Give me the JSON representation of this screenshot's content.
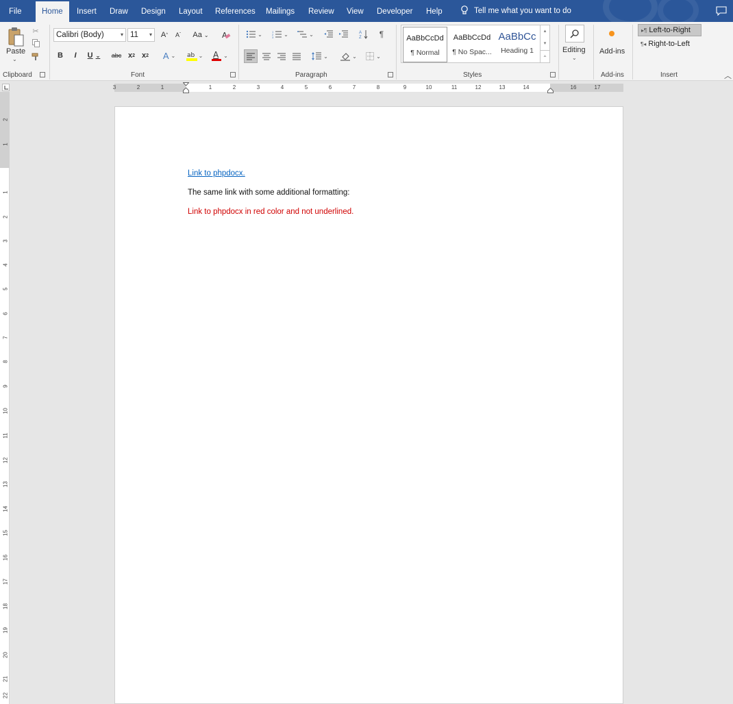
{
  "tabs": [
    {
      "label": "File",
      "active": false
    },
    {
      "label": "Home",
      "active": true
    },
    {
      "label": "Insert",
      "active": false
    },
    {
      "label": "Draw",
      "active": false
    },
    {
      "label": "Design",
      "active": false
    },
    {
      "label": "Layout",
      "active": false
    },
    {
      "label": "References",
      "active": false
    },
    {
      "label": "Mailings",
      "active": false
    },
    {
      "label": "Review",
      "active": false
    },
    {
      "label": "View",
      "active": false
    },
    {
      "label": "Developer",
      "active": false
    },
    {
      "label": "Help",
      "active": false
    }
  ],
  "tell_me": "Tell me what you want to do",
  "ribbon": {
    "clipboard": {
      "paste_label": "Paste",
      "group_label": "Clipboard"
    },
    "font": {
      "font_name": "Calibri (Body)",
      "font_size": "11",
      "change_case": "Aa",
      "group_label": "Font"
    },
    "paragraph": {
      "group_label": "Paragraph"
    },
    "styles": {
      "items": [
        {
          "preview": "AaBbCcDd",
          "name": "¶ Normal"
        },
        {
          "preview": "AaBbCcDd",
          "name": "¶ No Spac..."
        },
        {
          "preview": "AaBbCc",
          "name": "Heading 1"
        }
      ],
      "group_label": "Styles"
    },
    "editing": {
      "label": "Editing"
    },
    "addins": {
      "label": "Add-ins",
      "group_label": "Add-ins"
    },
    "insert": {
      "ltr_label": "Left-to-Right",
      "rtl_label": "Right-to-Left",
      "group_label": "Insert"
    }
  },
  "ruler": {
    "numbers": [
      "3",
      "2",
      "1",
      "1",
      "2",
      "3",
      "4",
      "5",
      "6",
      "7",
      "8",
      "9",
      "10",
      "11",
      "12",
      "13",
      "14",
      "16",
      "17"
    ],
    "vertical_numbers": [
      "2",
      "1",
      "1",
      "2",
      "3",
      "4",
      "5",
      "6",
      "7",
      "8",
      "9",
      "10",
      "11",
      "12",
      "13",
      "14",
      "15",
      "16",
      "17",
      "18",
      "19",
      "20",
      "21",
      "22"
    ]
  },
  "document": {
    "paragraphs": [
      {
        "text": "Link to phpdocx.",
        "style": "hyperlink"
      },
      {
        "text": "The same link with some additional formatting:",
        "style": "normal"
      },
      {
        "text": "Link to phpdocx in red color and not underlined.",
        "style": "red"
      }
    ]
  },
  "colors": {
    "titlebar": "#2b579a",
    "ribbon": "#f3f3f3",
    "hyperlink": "#0563c1",
    "red_text": "#d00000",
    "workspace": "#e6e6e6"
  }
}
